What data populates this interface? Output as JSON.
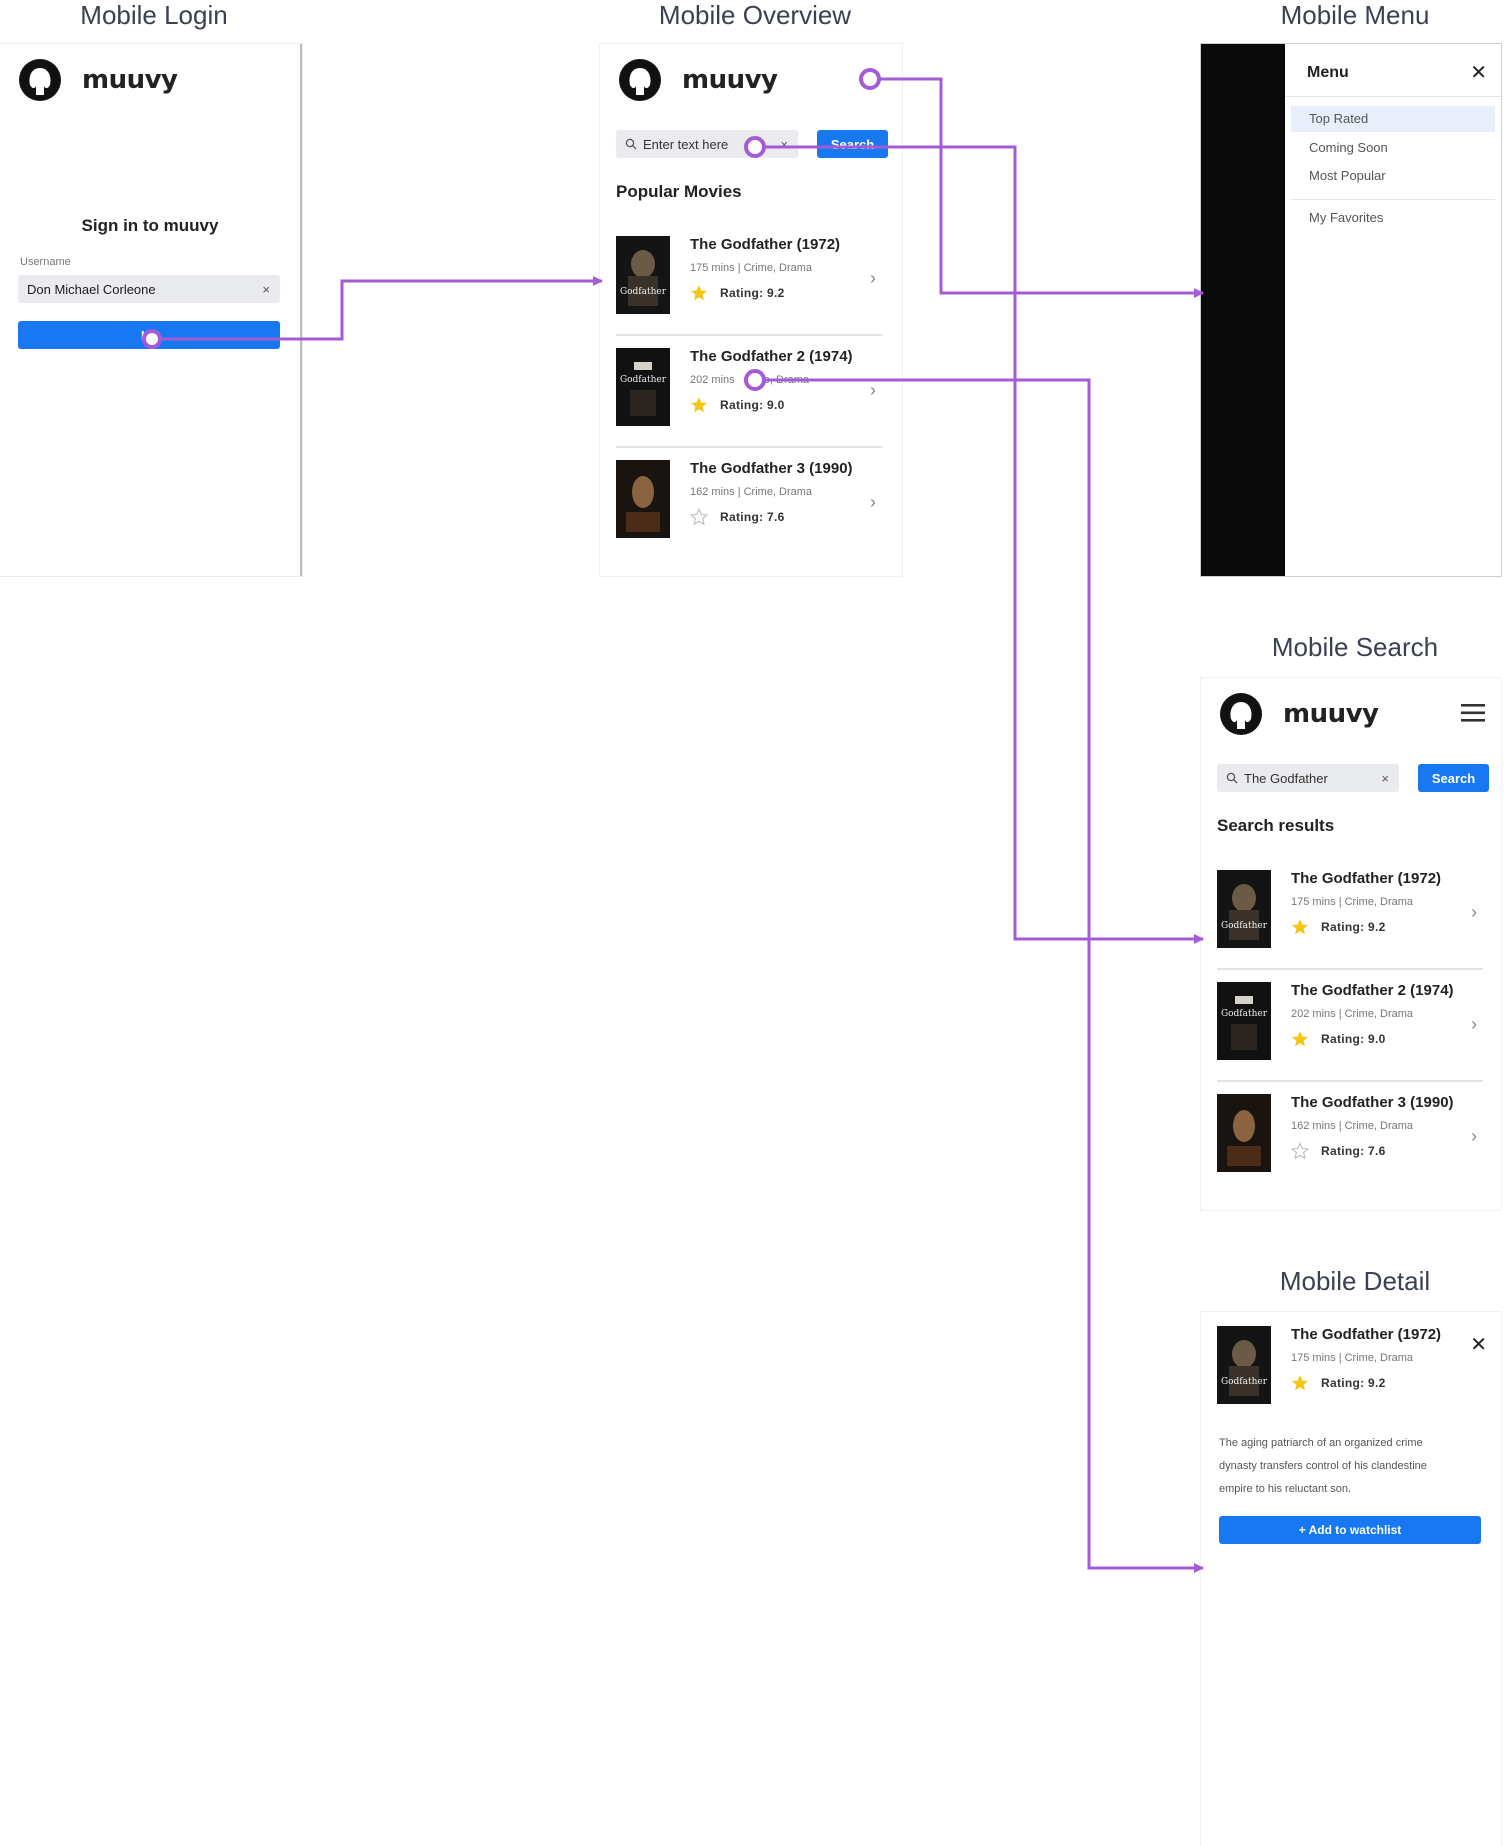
{
  "screens": {
    "login": "Mobile Login",
    "overview": "Mobile Overview",
    "menu": "Mobile Menu",
    "search": "Mobile Search",
    "detail": "Mobile Detail"
  },
  "brand": "muuvy",
  "login": {
    "heading": "Sign in to muuvy",
    "username_label": "Username",
    "username_value": "Don Michael Corleone",
    "clear": "×",
    "button": "Lo"
  },
  "overview": {
    "search_placeholder": "Enter text here",
    "clear": "×",
    "search_button": "Search",
    "section": "Popular Movies"
  },
  "menu": {
    "title": "Menu",
    "close": "✕",
    "items": [
      "Top Rated",
      "Coming Soon",
      "Most Popular"
    ],
    "extra_item": "My Favorites"
  },
  "search": {
    "query": "The Godfather",
    "clear": "×",
    "search_button": "Search",
    "section": "Search results"
  },
  "movies": [
    {
      "title": "The Godfather  (1972)",
      "meta": "175 mins | Crime, Drama",
      "rating": "Rating: 9.2",
      "rated": true
    },
    {
      "title": "The Godfather 2  (1974)",
      "meta": "202 mins | Crime, Drama",
      "rating": "Rating: 9.0",
      "rated": true
    },
    {
      "title": "The Godfather 3 (1990)",
      "meta": "162 mins | Crime, Drama",
      "rating": "Rating: 7.6",
      "rated": false
    }
  ],
  "overview_meta_partial": {
    "a": "202 mins",
    "b": "me, Drama"
  },
  "detail": {
    "title": "The Godfather  (1972)",
    "meta": "175 mins | Crime, Drama",
    "rating": "Rating: 9.2",
    "close": "✕",
    "description": "The aging patriarch of an organized crime dynasty transfers control of his clandestine empire to his reluctant son.",
    "watchlist_button": "+ Add to watchlist"
  },
  "icons": {
    "logo": "octocat-logo-icon",
    "search": "magnifier-icon",
    "menu": "hamburger-icon",
    "star_filled": "star-filled-icon",
    "star_empty": "star-outline-icon",
    "chevron": "chevron-right-icon"
  },
  "colors": {
    "accent": "#1778f2",
    "connector": "#a45bd6",
    "star": "#f5c518"
  }
}
